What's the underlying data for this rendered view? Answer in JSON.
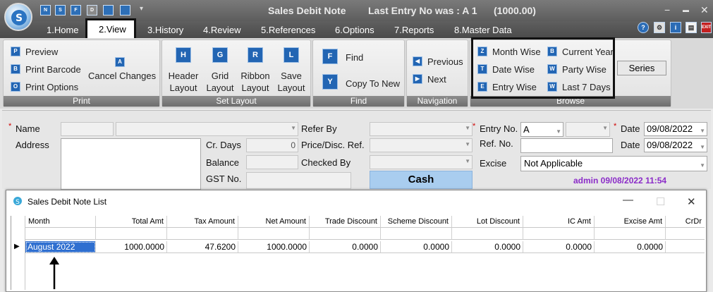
{
  "window": {
    "title": "Sales Debit Note",
    "last_entry": "Last Entry No was : A 1",
    "last_amount": "(1000.00)",
    "controls": {
      "minimize": "−",
      "restore": "▬",
      "close": "✕"
    },
    "quick_access_icons": [
      "N",
      "S",
      "F",
      "D",
      "",
      "",
      "▾"
    ]
  },
  "menu": {
    "items": [
      "1.Home",
      "2.View",
      "3.History",
      "4.Review",
      "5.References",
      "6.Options",
      "7.Reports",
      "8.Master Data"
    ],
    "active": "2.View",
    "help_icons": [
      "help-icon",
      "settings-icon",
      "info-icon",
      "document-icon",
      "exit-icon"
    ],
    "exit_label": "EXIT"
  },
  "ribbon": {
    "print": {
      "label": "Print",
      "preview": "Preview",
      "print_barcode": "Print Barcode",
      "print_options": "Print Options",
      "cancel_changes": "Cancel Changes"
    },
    "set_layout": {
      "label": "Set Layout",
      "header_1": "Header",
      "header_2": "Layout",
      "grid_1": "Grid",
      "grid_2": "Layout",
      "ribbon_1": "Ribbon",
      "ribbon_2": "Layout",
      "save_1": "Save",
      "save_2": "Layout"
    },
    "find": {
      "label": "Find",
      "find": "Find",
      "copy_to_new": "Copy To New"
    },
    "navigation": {
      "label": "Navigation",
      "previous": "Previous",
      "next": "Next"
    },
    "browse": {
      "label": "Browse",
      "month_wise": "Month Wise",
      "date_wise": "Date Wise",
      "entry_wise": "Entry Wise",
      "current_year": "Current Year",
      "party_wise": "Party Wise",
      "last_7_days": "Last 7 Days",
      "series": "Series"
    }
  },
  "form": {
    "name_label": "Name",
    "address_label": "Address",
    "cr_days_label": "Cr. Days",
    "cr_days_value": "0",
    "balance_label": "Balance",
    "gst_label": "GST No.",
    "refer_by_label": "Refer By",
    "price_disc_label": "Price/Disc. Ref.",
    "checked_by_label": "Checked By",
    "cash_label": "Cash",
    "entry_no_label": "Entry No.",
    "entry_no_value": "A",
    "ref_no_label": "Ref. No.",
    "excise_label": "Excise",
    "excise_value": "Not Applicable",
    "date_label": "Date",
    "date_value": "09/08/2022",
    "date2_label": "Date",
    "date2_value": "09/08/2022",
    "admin_stamp": "admin 09/08/2022 11:54",
    "required_mark": "*"
  },
  "list_window": {
    "title": "Sales Debit Note List",
    "columns": [
      "Month",
      "Total Amt",
      "Tax Amount",
      "Net Amount",
      "Trade Discount",
      "Scheme Discount",
      "Lot Discount",
      "IC Amt",
      "Excise Amt",
      "CrDr"
    ],
    "rows": [
      {
        "cells": [
          "August 2022",
          "1000.0000",
          "47.6200",
          "1000.0000",
          "0.0000",
          "0.0000",
          "0.0000",
          "0.0000",
          "0.0000",
          ""
        ]
      }
    ],
    "row_pointer": "▶"
  },
  "colors": {
    "titlebar": "#6a6a6a",
    "accent": "#2265b3",
    "cash_button": "#a9cdef",
    "selected_row": "#2f6fd0",
    "admin_text": "#8b2cc8"
  }
}
